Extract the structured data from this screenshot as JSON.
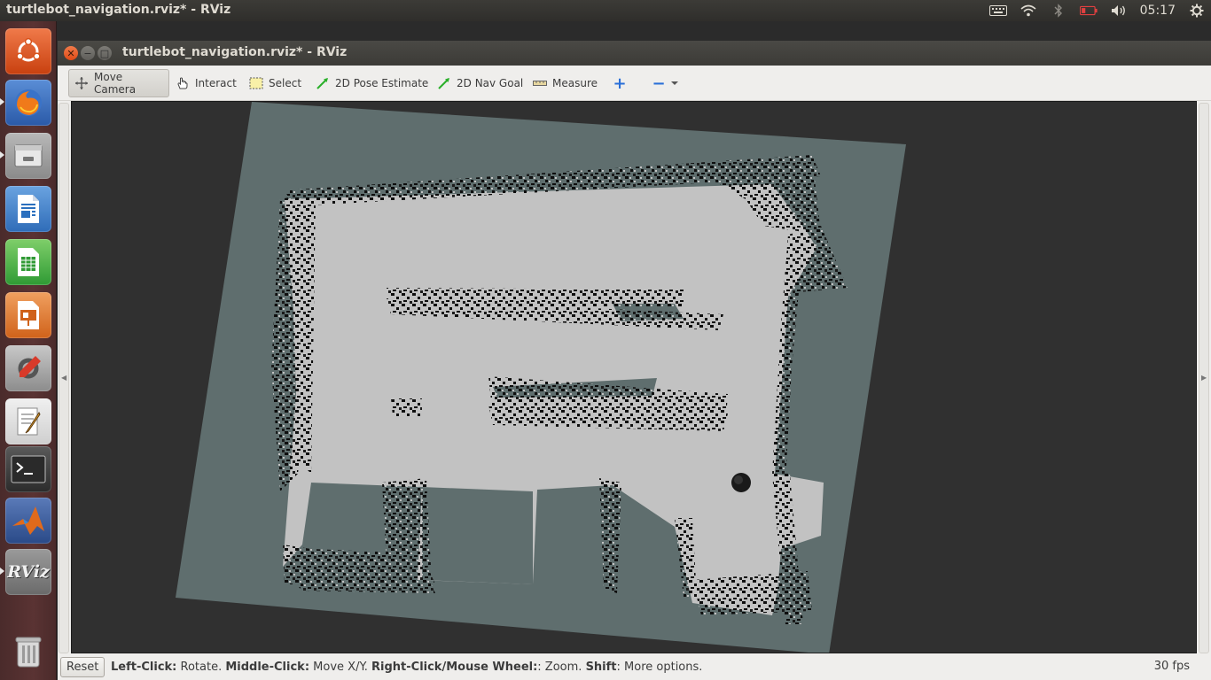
{
  "top_panel": {
    "title": "turtlebot_navigation.rviz* - RViz",
    "clock": "05:17"
  },
  "launcher": {
    "items": [
      {
        "name": "ubuntu-dash-icon",
        "color": "#e95420"
      },
      {
        "name": "firefox-icon",
        "color": "#e66000"
      },
      {
        "name": "files-icon",
        "color": "#8a8a8a"
      },
      {
        "name": "libreoffice-writer-icon",
        "color": "#2a6fbe"
      },
      {
        "name": "libreoffice-calc-icon",
        "color": "#2f9a34"
      },
      {
        "name": "libreoffice-impress-icon",
        "color": "#d0621a"
      },
      {
        "name": "system-settings-icon",
        "color": "#9a9a9a"
      },
      {
        "name": "text-editor-icon",
        "color": "#dcdcdc"
      },
      {
        "name": "terminal-icon",
        "color": "#2b2b2b"
      },
      {
        "name": "matlab-icon",
        "color": "#e06a1c"
      },
      {
        "name": "rviz-icon",
        "color": "#7a7a7a"
      },
      {
        "name": "trash-icon",
        "color": "#cfcfcf"
      }
    ],
    "rviz_label": "RViz"
  },
  "window": {
    "title": "turtlebot_navigation.rviz* - RViz",
    "close_glyph": "✕",
    "min_glyph": "−",
    "max_glyph": "□"
  },
  "toolbar": {
    "move_camera": "Move Camera",
    "interact": "Interact",
    "select": "Select",
    "pose_estimate": "2D Pose Estimate",
    "nav_goal": "2D Nav Goal",
    "measure": "Measure",
    "add_glyph": "+",
    "remove_glyph": "−"
  },
  "status": {
    "reset": "Reset",
    "left_click_key": "Left-Click:",
    "left_click_val": " Rotate. ",
    "middle_click_key": "Middle-Click:",
    "middle_click_val": " Move X/Y. ",
    "right_click_key": "Right-Click/Mouse Wheel:",
    "right_click_val": ": Zoom. ",
    "shift_key": "Shift",
    "shift_val": ": More options.",
    "fps": "30 fps"
  },
  "colors": {
    "map_unknown": "#5f6e6e",
    "map_free": "#c2c2c2",
    "map_occupied": "#0e0e0e",
    "background": "#303030"
  }
}
